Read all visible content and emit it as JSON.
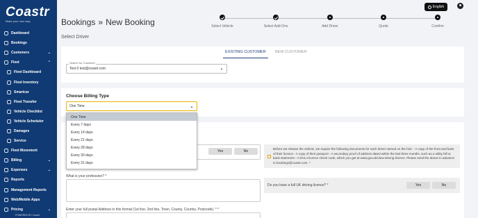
{
  "sidebar": {
    "logo_text": "Coastr",
    "logo_tagline": "Make your own way.",
    "items": [
      {
        "label": "Dashboard",
        "icon": "dashboard-icon",
        "chevron": ""
      },
      {
        "label": "Bookings",
        "icon": "bookings-icon",
        "chevron": ""
      },
      {
        "label": "Customers",
        "icon": "customers-icon",
        "chevron": "⌄"
      },
      {
        "label": "Fleet",
        "icon": "car-icon",
        "chevron": "⌃"
      },
      {
        "label": "Fleet Dashboard",
        "icon": "fleet-dashboard-icon",
        "chevron": ""
      },
      {
        "label": "Fleet Inventory",
        "icon": "fleet-inventory-icon",
        "chevron": ""
      },
      {
        "label": "Smartcar",
        "icon": "smartcar-icon",
        "chevron": ""
      },
      {
        "label": "Fleet Transfer",
        "icon": "fleet-transfer-icon",
        "chevron": ""
      },
      {
        "label": "Vehicle Checklist",
        "icon": "checklist-icon",
        "chevron": ""
      },
      {
        "label": "Vehicle Scheduler",
        "icon": "scheduler-icon",
        "chevron": ""
      },
      {
        "label": "Damages",
        "icon": "warning-icon",
        "chevron": ""
      },
      {
        "label": "Service",
        "icon": "wrench-icon",
        "chevron": ""
      },
      {
        "label": "Fleet Movement",
        "icon": "fleet-movement-icon",
        "chevron": ""
      },
      {
        "label": "Billing",
        "icon": "billing-icon",
        "chevron": "⌄"
      },
      {
        "label": "Expenses",
        "icon": "expenses-icon",
        "chevron": "⌄"
      },
      {
        "label": "Reports",
        "icon": "reports-icon",
        "chevron": ""
      },
      {
        "label": "Management Reports",
        "icon": "management-reports-icon",
        "chevron": ""
      },
      {
        "label": "Web/Mobile Apps",
        "icon": "apps-icon",
        "chevron": ""
      },
      {
        "label": "Pricing",
        "icon": "pricing-icon",
        "chevron": "⌄"
      }
    ],
    "powered_by": "POWERED BY Coastr"
  },
  "header": {
    "crumb_1": "Bookings",
    "separator": "»",
    "crumb_2": "New  Booking",
    "language": "English"
  },
  "stepper": {
    "steps": [
      {
        "label": "Select Vehicle",
        "number": "",
        "state": "done"
      },
      {
        "label": "Select Add-Ons",
        "number": "",
        "state": "done"
      },
      {
        "label": "Add Driver",
        "number": "",
        "state": "pending"
      },
      {
        "label": "Quote",
        "number": "",
        "state": "pending"
      },
      {
        "label": "Confirm",
        "number": "",
        "state": "pending"
      }
    ]
  },
  "section_title": "Select Driver",
  "customer": {
    "tab_existing": "EXISTING CUSTOMER",
    "tab_new": "NEW CUSTOMER",
    "search_label": "Search for Customer",
    "search_value": "Test 0 test@coastr.com"
  },
  "billing": {
    "heading": "Choose Billing Type",
    "selected": "One Time",
    "options": [
      "One Time",
      "Every 7 days",
      "Every 14 days",
      "Every 21 days",
      "Every 28 days",
      "Every 30 days",
      "Every 31 days"
    ]
  },
  "driver_form": {
    "yes": "Yes",
    "no": "No",
    "notice": "Before we release the vehicle, we require the following documents for each driver named on the hire: - A copy of the front and back of their licence - A copy of their passport - A secondary proof of address dated within the last three months, such as a utility bill or bank statement - A DVLA licence check code, which you get at www.gov.uk/view-driving-licence. Please send the above in advance to bookings@coastr.com. *",
    "profession_label": "What is your profession? *",
    "licence_label": "Do you have a full UK driving licence? *",
    "address_label": "Enter your full postal Address in this format (1st line, 2nd line, Town, County, Country, Postcode). * *"
  },
  "colors": {
    "sidebar": "#103a73",
    "accent": "#1d3f7a",
    "billing_border": "#e8b400"
  }
}
